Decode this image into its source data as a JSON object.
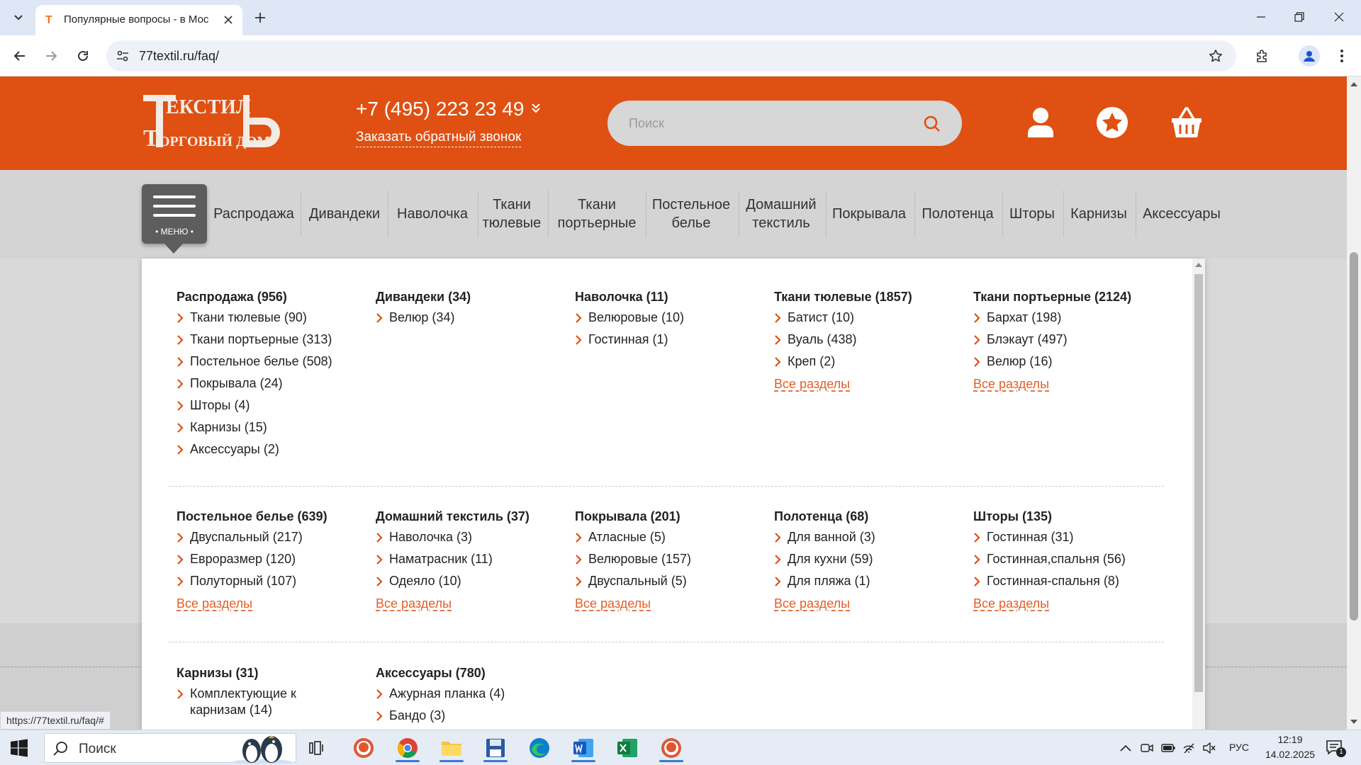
{
  "browser": {
    "tab_title": "Популярные вопросы - в Мос",
    "url": "77textil.ru/faq/"
  },
  "header": {
    "logo_text_top": "ЕКСТИЛ",
    "logo_text_bottom": "ОРГОВЫЙ ДОМ",
    "phone": "+7 (495) 223 23 49",
    "callback": "Заказать обратный звонок",
    "search_placeholder": "Поиск",
    "brand_color": "#df5012"
  },
  "nav": {
    "menu_label": "• МЕНЮ •",
    "items": [
      {
        "label": "Распродажа"
      },
      {
        "label": "Дивандеки"
      },
      {
        "label": "Наволочка"
      },
      {
        "label": "Ткани тюлевые"
      },
      {
        "label": "Ткани портьерные"
      },
      {
        "label": "Постельное белье"
      },
      {
        "label": "Домашний текстиль"
      },
      {
        "label": "Покрывала"
      },
      {
        "label": "Полотенца"
      },
      {
        "label": "Шторы"
      },
      {
        "label": "Карнизы"
      },
      {
        "label": "Аксессуары"
      }
    ]
  },
  "mega_menu": {
    "all_label": "Все разделы",
    "columns": [
      {
        "title": "Распродажа (956)",
        "items": [
          "Ткани тюлевые (90)",
          "Ткани портьерные (313)",
          "Постельное белье (508)",
          "Покрывала (24)",
          "Шторы (4)",
          "Карнизы (15)",
          "Аксессуары (2)"
        ],
        "show_all": false
      },
      {
        "title": "Дивандеки (34)",
        "items": [
          "Велюр (34)"
        ],
        "show_all": false
      },
      {
        "title": "Наволочка (11)",
        "items": [
          "Велюровые (10)",
          "Гостинная (1)"
        ],
        "show_all": false
      },
      {
        "title": "Ткани тюлевые (1857)",
        "items": [
          "Батист (10)",
          "Вуаль (438)",
          "Креп (2)"
        ],
        "show_all": true
      },
      {
        "title": "Ткани портьерные (2124)",
        "items": [
          "Бархат (198)",
          "Блэкаут (497)",
          "Велюр (16)"
        ],
        "show_all": true
      },
      {
        "title": "Постельное белье (639)",
        "items": [
          "Двуспальный (217)",
          "Евроразмер (120)",
          "Полуторный (107)"
        ],
        "show_all": true
      },
      {
        "title": "Домашний текстиль (37)",
        "items": [
          "Наволочка (3)",
          "Наматрасник (11)",
          "Одеяло (10)"
        ],
        "show_all": true
      },
      {
        "title": "Покрывала (201)",
        "items": [
          "Атласные (5)",
          "Велюровые (157)",
          "Двуспальный (5)"
        ],
        "show_all": true
      },
      {
        "title": "Полотенца (68)",
        "items": [
          "Для ванной (3)",
          "Для кухни (59)",
          "Для пляжа (1)"
        ],
        "show_all": true
      },
      {
        "title": "Шторы (135)",
        "items": [
          "Гостинная (31)",
          "Гостинная,спальня (56)",
          "Гостинная-спальня (8)"
        ],
        "show_all": true
      },
      {
        "title": "Карнизы (31)",
        "items": [
          "Комплектующие к карнизам (14)"
        ],
        "show_all": false
      },
      {
        "title": "Аксессуары (780)",
        "items": [
          "Ажурная планка (4)",
          "Бандо (3)"
        ],
        "show_all": false
      }
    ]
  },
  "status_bar_url": "https://77textil.ru/faq/#",
  "taskbar": {
    "search_label": "Поиск",
    "lang": "РУС",
    "time": "12:19",
    "date": "14.02.2025",
    "notification_count": "1"
  }
}
